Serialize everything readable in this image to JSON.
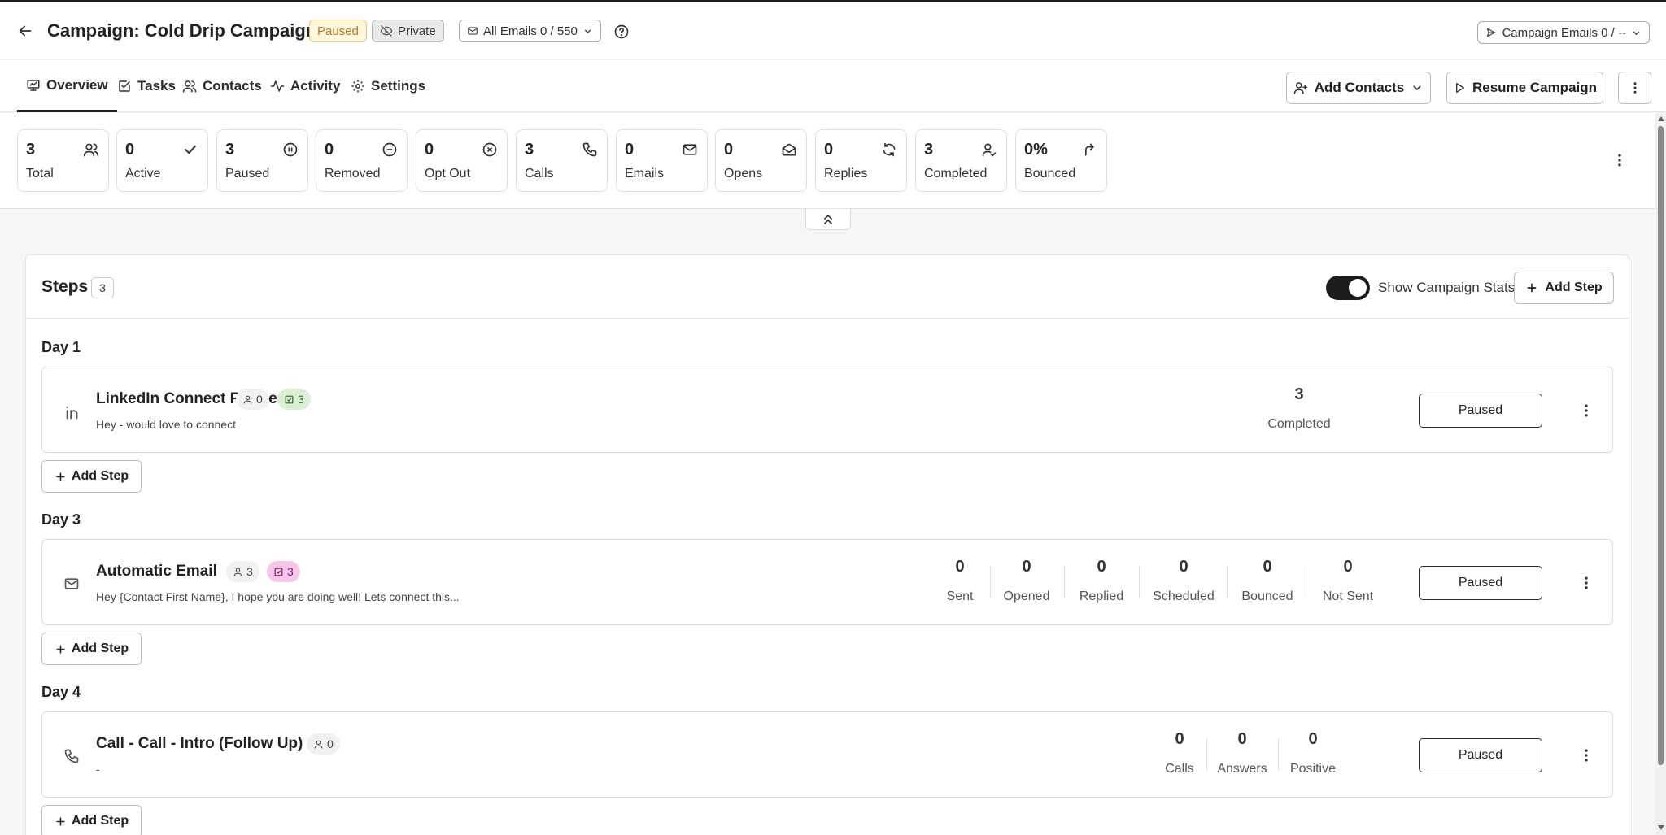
{
  "header": {
    "title": "Campaign: Cold Drip Campaign",
    "status_badge": "Paused",
    "private_label": "Private",
    "all_emails_label": "All Emails 0 / 550",
    "campaign_emails_label": "Campaign Emails 0 / --"
  },
  "tabs": [
    {
      "label": "Overview",
      "icon": "presentation-icon",
      "active": true
    },
    {
      "label": "Tasks",
      "icon": "checkbox-icon"
    },
    {
      "label": "Contacts",
      "icon": "users-icon"
    },
    {
      "label": "Activity",
      "icon": "activity-icon"
    },
    {
      "label": "Settings",
      "icon": "gear-icon"
    }
  ],
  "actions": {
    "add_contacts": "Add Contacts",
    "resume_campaign": "Resume Campaign"
  },
  "stats": [
    {
      "value": "3",
      "label": "Total",
      "icon": "users-icon"
    },
    {
      "value": "0",
      "label": "Active",
      "icon": "check-icon"
    },
    {
      "value": "3",
      "label": "Paused",
      "icon": "pause-circle-icon"
    },
    {
      "value": "0",
      "label": "Removed",
      "icon": "minus-circle-icon"
    },
    {
      "value": "0",
      "label": "Opt Out",
      "icon": "x-circle-icon"
    },
    {
      "value": "3",
      "label": "Calls",
      "icon": "phone-icon"
    },
    {
      "value": "0",
      "label": "Emails",
      "icon": "mail-icon"
    },
    {
      "value": "0",
      "label": "Opens",
      "icon": "mail-open-icon"
    },
    {
      "value": "0",
      "label": "Replies",
      "icon": "refresh-icon"
    },
    {
      "value": "3",
      "label": "Completed",
      "icon": "user-check-icon"
    },
    {
      "value": "0%",
      "label": "Bounced",
      "icon": "bounce-arrow-icon"
    }
  ],
  "steps_section": {
    "title": "Steps",
    "count": "3",
    "show_stats_label": "Show Campaign Stats",
    "add_step_label": "Add Step"
  },
  "days": [
    {
      "day_label": "Day 1",
      "step": {
        "icon": "linkedin-icon",
        "name": "LinkedIn Connect Request",
        "description": "Hey - would love to connect",
        "contacts_count": "0",
        "tasks_count": "3",
        "status": "Paused",
        "metrics": [
          {
            "value": "3",
            "label": "Completed"
          }
        ]
      }
    },
    {
      "day_label": "Day 3",
      "step": {
        "icon": "mail-icon",
        "name": "Automatic Email",
        "description": "Hey {Contact First Name}, I hope you are doing well! Lets connect this...",
        "contacts_count": "3",
        "tasks_count": "3",
        "status": "Paused",
        "metrics": [
          {
            "value": "0",
            "label": "Sent"
          },
          {
            "value": "0",
            "label": "Opened"
          },
          {
            "value": "0",
            "label": "Replied"
          },
          {
            "value": "0",
            "label": "Scheduled"
          },
          {
            "value": "0",
            "label": "Bounced"
          },
          {
            "value": "0",
            "label": "Not Sent"
          }
        ]
      }
    },
    {
      "day_label": "Day 4",
      "step": {
        "icon": "phone-icon",
        "name": "Call - Call - Intro (Follow Up)",
        "description": "-",
        "contacts_count": "0",
        "status": "Paused",
        "metrics": [
          {
            "value": "0",
            "label": "Calls"
          },
          {
            "value": "0",
            "label": "Answers"
          },
          {
            "value": "0",
            "label": "Positive"
          }
        ]
      }
    }
  ],
  "add_step_button": "Add Step"
}
